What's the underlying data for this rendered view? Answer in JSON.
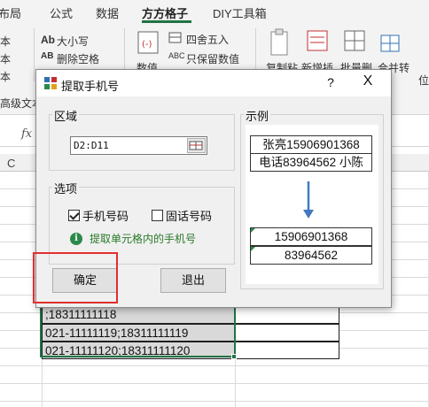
{
  "ribbon_tabs": [
    {
      "label": "布局"
    },
    {
      "label": "公式"
    },
    {
      "label": "数据"
    },
    {
      "label": "方方格子"
    },
    {
      "label": "DIY工具箱"
    }
  ],
  "ribbon": {
    "left_items": [
      "本",
      "本",
      "本",
      "高级文本"
    ],
    "big_small_label": "大小写",
    "delete_space_label": "删除空格",
    "numeric_label": "数值",
    "round_label": "四舍五入",
    "keep_values_label": "只保留数值",
    "copy_paste_label": "复制粘",
    "add_insert_label": "新增插",
    "batch_delete_label": "批量删",
    "merge_convert_label": "合并转",
    "position_label": "位",
    "accent_color": "#217346"
  },
  "formula_bar": {
    "fx_label": "fx"
  },
  "sheet": {
    "column_header": "C",
    "rows": [
      ";18311111118",
      "021-11111119;18311111119",
      "021-11111120;18311111120"
    ]
  },
  "dialog": {
    "title": "提取手机号",
    "help_label": "?",
    "close_label": "X",
    "region_group_label": "区域",
    "range_value": "D2:D11",
    "options_group_label": "选项",
    "mobile_option_label": "手机号码",
    "mobile_checked": true,
    "landline_option_label": "固话号码",
    "landline_checked": false,
    "hint_text": "提取单元格内的手机号",
    "ok_label": "确定",
    "exit_label": "退出",
    "example_group_label": "示例",
    "example_input_1": "张亮15906901368",
    "example_input_2": "电话83964562 小陈",
    "example_output_1": "15906901368",
    "example_output_2": "83964562",
    "highlight_color": "#e03030"
  }
}
